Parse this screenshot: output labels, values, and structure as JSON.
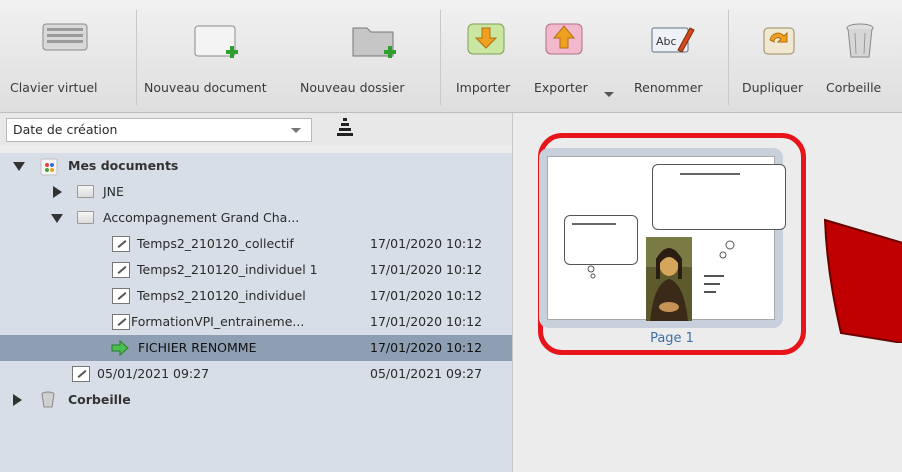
{
  "toolbar": {
    "clavier": "Clavier virtuel",
    "nouveau_document": "Nouveau document",
    "nouveau_dossier": "Nouveau dossier",
    "importer": "Importer",
    "exporter": "Exporter",
    "renommer": "Renommer",
    "dupliquer": "Dupliquer",
    "corbeille": "Corbeille"
  },
  "sort": {
    "selected": "Date de création"
  },
  "tree": {
    "root": "Mes documents",
    "jne": "JNE",
    "accomp": "Accompagnement Grand Cha...",
    "files": [
      {
        "name": "Temps2_210120_collectif",
        "date": "17/01/2020 10:12"
      },
      {
        "name": "Temps2_210120_individuel 1",
        "date": "17/01/2020 10:12"
      },
      {
        "name": "Temps2_210120_individuel",
        "date": "17/01/2020 10:12"
      },
      {
        "name": "FormationVPI_entraineme...",
        "date": "17/01/2020 10:12"
      },
      {
        "name": "FICHIER RENOMME",
        "date": "17/01/2020 10:12"
      }
    ],
    "root_file": {
      "name": "05/01/2021 09:27",
      "date": "05/01/2021 09:27"
    },
    "trash": "Corbeille"
  },
  "preview": {
    "page_label": "Page 1"
  },
  "colors": {
    "highlight": "#e8141b",
    "selected_row": "#8e9fb3",
    "page_label": "#3d6fa6"
  }
}
